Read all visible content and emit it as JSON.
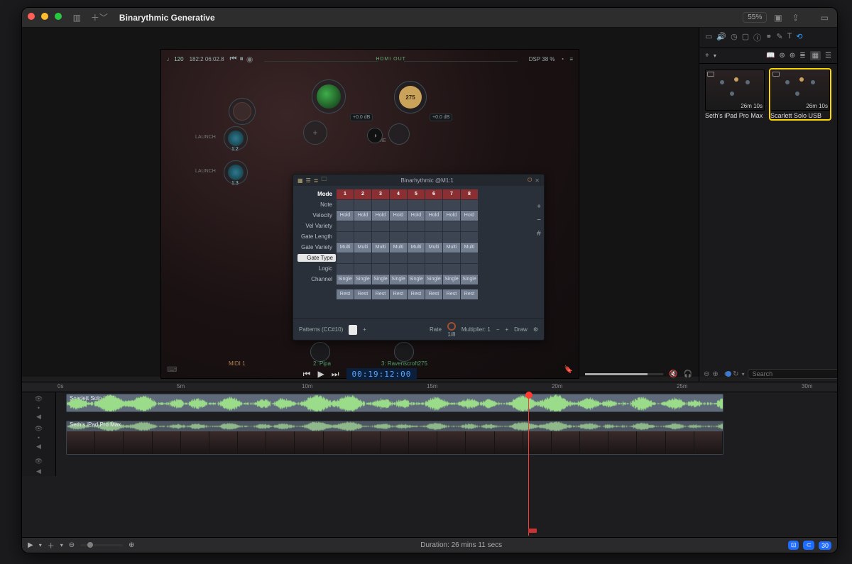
{
  "titlebar": {
    "project_title": "Binarythmic Generative",
    "zoom": "55%"
  },
  "sidepanel": {
    "add_label": "+",
    "thumbs": [
      {
        "label": "Seth's iPad Pro Max",
        "duration": "26m 10s",
        "selected": false
      },
      {
        "label": "Scarlett Solo USB",
        "duration": "26m 10s",
        "selected": true
      }
    ]
  },
  "ipad": {
    "bpm_label": "♩ 120",
    "bars_beats": "182:2  06:02.8",
    "hdmi": "HDMI OUT",
    "dsp": "DSP 38 %",
    "launch1": "LAUNCH",
    "launch2": "LAUNCH",
    "time": "TIME",
    "io1": "+0.0 dB",
    "io2": "+0.0 dB",
    "midi_label": "MIDI 1",
    "inst2": "2: Pipa",
    "inst3": "3: Ravenscroft275",
    "big_number": "275",
    "c1": "1:2",
    "c2": "1:3"
  },
  "midipanel": {
    "title": "Binarhythmic @M1:1",
    "rows": {
      "mode": "Mode",
      "note": "Note",
      "velocity": "Velocity",
      "vel_variety": "Vel Variety",
      "gate_length": "Gate Length",
      "gate_variety": "Gate Variety",
      "gate_type": "Gate Type",
      "logic": "Logic",
      "channel": "Channel"
    },
    "steps": [
      "1",
      "2",
      "3",
      "4",
      "5",
      "6",
      "7",
      "8"
    ],
    "hold": "Hold",
    "multi": "Multi",
    "single": "Single",
    "rest": "Rest",
    "patterns": "Patterns (CC#10)",
    "rate": "Rate",
    "rate_div": "1/8",
    "multiplier": "Multiplier: 1",
    "draw": "Draw",
    "settings": "Settings"
  },
  "transport": {
    "timecode": "00:19:12:00"
  },
  "ruler": {
    "t0": "0s",
    "t5": "5m",
    "t10": "10m",
    "t15": "15m",
    "t20": "20m",
    "t25": "25m",
    "t30": "30m"
  },
  "tracks": {
    "a": "Scarlett Solo USB",
    "b": "Seth's iPad Pro Max"
  },
  "footer": {
    "duration": "Duration: 26 mins 11 secs",
    "badge": "30"
  },
  "search": {
    "placeholder": "Search"
  }
}
